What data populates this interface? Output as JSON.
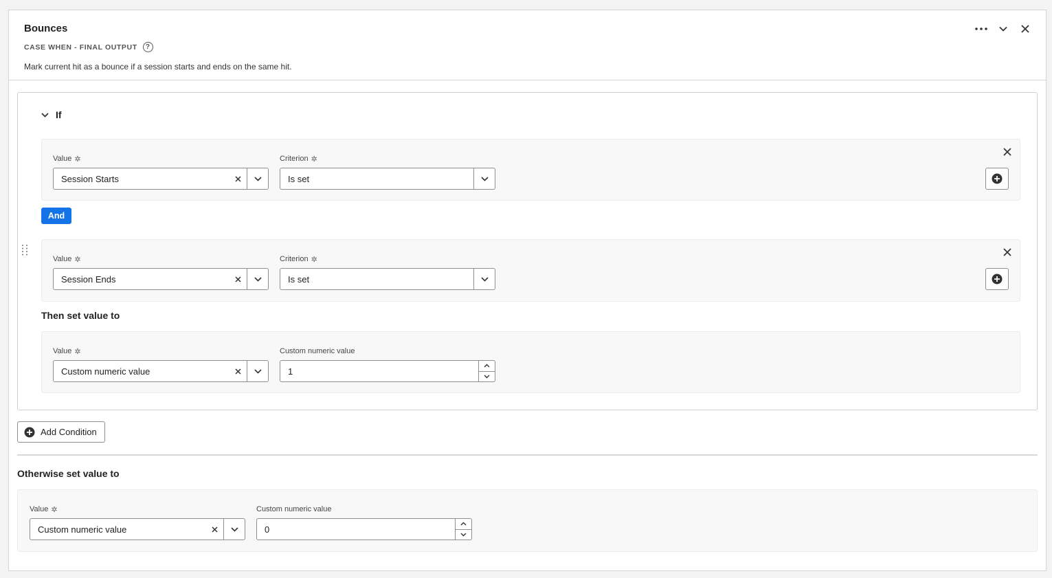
{
  "header": {
    "title": "Bounces",
    "subtitle": "CASE WHEN - FINAL OUTPUT",
    "description": "Mark current hit as a bounce if a session starts and ends on the same hit."
  },
  "if_block": {
    "label": "If",
    "conditions": [
      {
        "value_label": "Value",
        "value": "Session Starts",
        "criterion_label": "Criterion",
        "criterion": "Is set"
      },
      {
        "value_label": "Value",
        "value": "Session Ends",
        "criterion_label": "Criterion",
        "criterion": "Is set"
      }
    ],
    "and_label": "And",
    "then_title": "Then set value to",
    "then": {
      "value_label": "Value",
      "value": "Custom numeric value",
      "custom_label": "Custom numeric value",
      "custom_value": "1"
    }
  },
  "add_condition_label": "Add Condition",
  "otherwise": {
    "title": "Otherwise set value to",
    "value_label": "Value",
    "value": "Custom numeric value",
    "custom_label": "Custom numeric value",
    "custom_value": "0"
  },
  "colors": {
    "accent": "#1473e6"
  }
}
